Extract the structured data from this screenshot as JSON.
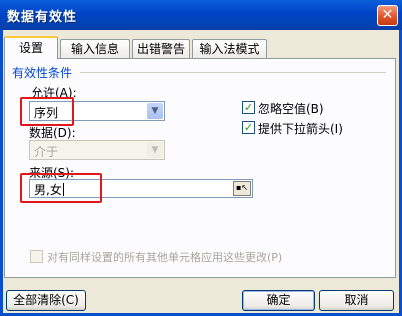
{
  "window": {
    "title": "数据有效性",
    "close_glyph": "✕"
  },
  "tabs": [
    {
      "label": "设置",
      "active": true
    },
    {
      "label": "输入信息",
      "active": false
    },
    {
      "label": "出错警告",
      "active": false
    },
    {
      "label": "输入法模式",
      "active": false
    }
  ],
  "criteria": {
    "group_title": "有效性条件",
    "allow_label": "允许(A):",
    "allow_value": "序列",
    "data_label": "数据(D):",
    "data_value": "介于",
    "source_label": "来源(S):",
    "source_value": "男,女"
  },
  "options": {
    "ignore_blank_label": "忽略空值(B)",
    "ignore_blank_checked": true,
    "dropdown_label": "提供下拉箭头(I)",
    "dropdown_checked": true,
    "apply_all_label": "对有同样设置的所有其他单元格应用这些更改(P)",
    "apply_all_checked": false
  },
  "buttons": {
    "clear_all": "全部清除(C)",
    "ok": "确定",
    "cancel": "取消"
  },
  "icons": {
    "close": "close-icon",
    "dropdown": "chevron-down-icon",
    "checkmark": "checkmark-icon",
    "range_select": "range-select-icon"
  },
  "colors": {
    "titlebar": "#0A5FD8",
    "group_title": "#0046D5",
    "highlight": "#E0181C",
    "dialog_bg": "#ECE9D8"
  }
}
